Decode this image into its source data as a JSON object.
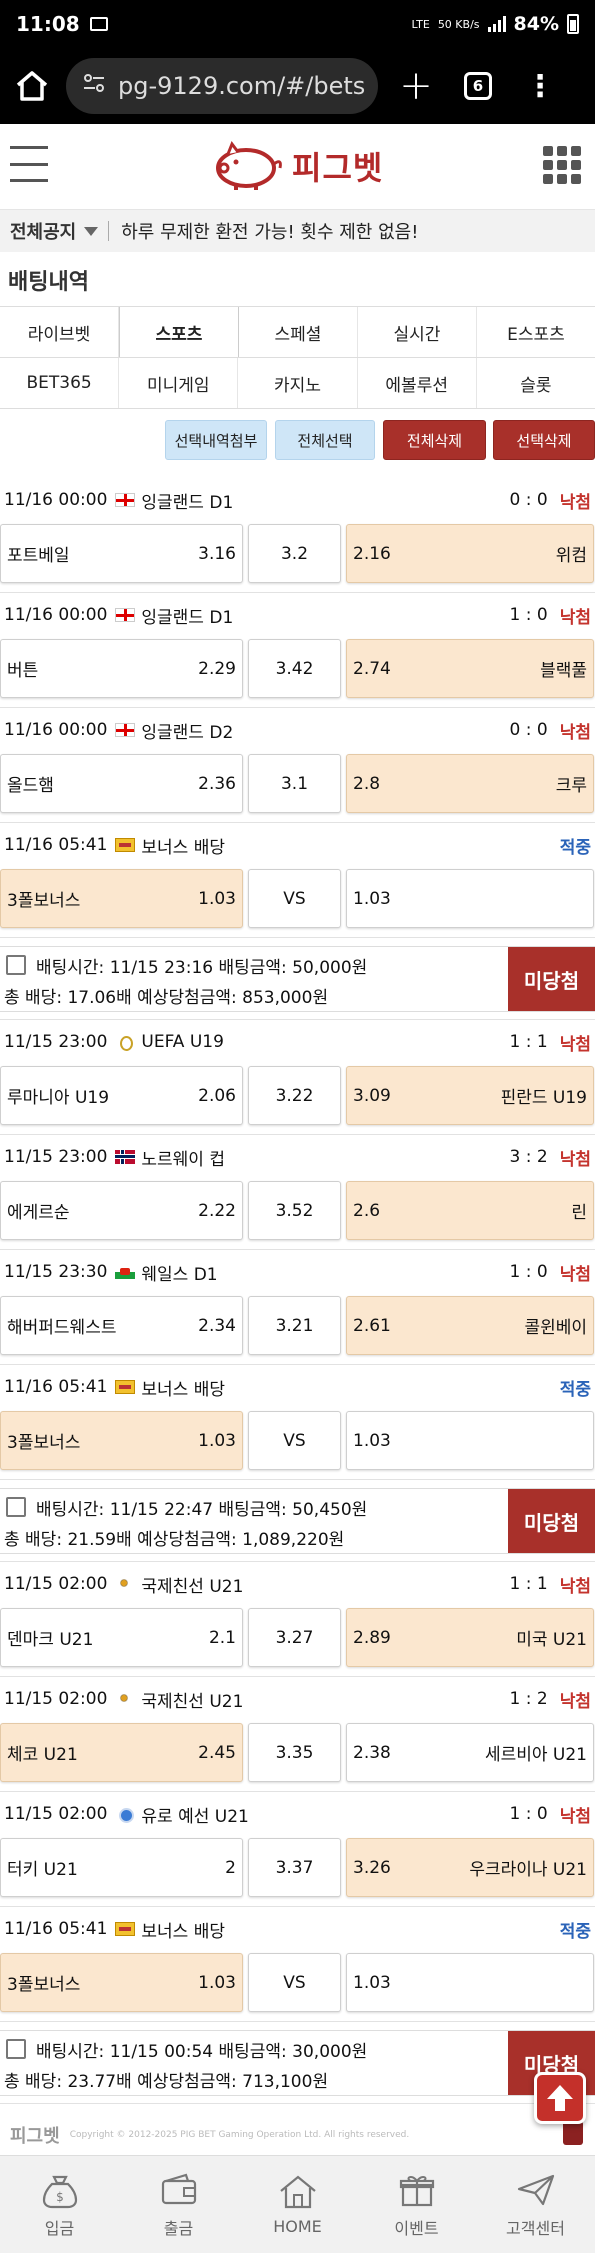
{
  "status": {
    "time": "11:08",
    "net": "LTE",
    "speed": "50 KB/s",
    "battery": "84%"
  },
  "browser": {
    "url": "pg-9129.com/#/bets",
    "tab_count": "6",
    "plus": "+",
    "menu": "⋮"
  },
  "site": {
    "logo_text": "피그벳"
  },
  "notice": {
    "label": "전체공지",
    "text": "하루 무제한 환전 가능! 횟수 제한 없음!"
  },
  "page_title": "배팅내역",
  "tabs_row1": [
    "라이브벳",
    "스포츠",
    "스페셜",
    "실시간",
    "E스포츠"
  ],
  "tabs_row2": [
    "BET365",
    "미니게임",
    "카지노",
    "에볼루션",
    "슬롯"
  ],
  "actions": {
    "attach": "선택내역첨부",
    "select_all": "전체선택",
    "delete_all": "전체삭제",
    "delete_selected": "선택삭제"
  },
  "slips": [
    {
      "bets": [
        {
          "time": "11/16 00:00",
          "flag": "england-flag",
          "league": "잉글랜드 D1",
          "score": "0 : 0",
          "result": "낙첨",
          "result_kind": "lose",
          "home": "포트베일",
          "home_odd": "3.16",
          "draw": "3.2",
          "away": "위컴",
          "away_odd": "2.16",
          "pick": "away"
        },
        {
          "time": "11/16 00:00",
          "flag": "england-flag",
          "league": "잉글랜드 D1",
          "score": "1 : 0",
          "result": "낙첨",
          "result_kind": "lose",
          "home": "버튼",
          "home_odd": "2.29",
          "draw": "3.42",
          "away": "블랙풀",
          "away_odd": "2.74",
          "pick": "away"
        },
        {
          "time": "11/16 00:00",
          "flag": "england-flag",
          "league": "잉글랜드 D2",
          "score": "0 : 0",
          "result": "낙첨",
          "result_kind": "lose",
          "home": "올드햄",
          "home_odd": "2.36",
          "draw": "3.1",
          "away": "크루",
          "away_odd": "2.8",
          "pick": "away"
        },
        {
          "time": "11/16 05:41",
          "flag": "bonus-icon",
          "league": "보너스 배당",
          "score": "",
          "result": "적중",
          "result_kind": "hit",
          "home": "3폴보너스",
          "home_odd": "1.03",
          "draw": "VS",
          "away": "",
          "away_odd": "1.03",
          "pick": "home"
        }
      ],
      "summary": {
        "bet_time": "배팅시간: 11/15 23:16",
        "amount": "배팅금액: 50,000원",
        "total_odds": "총 배당: 17.06배",
        "expected": "예상당첨금액: 853,000원",
        "status": "미당첨"
      }
    },
    {
      "bets": [
        {
          "time": "11/15 23:00",
          "flag": "uefa-icon",
          "league": "UEFA U19",
          "score": "1 : 1",
          "result": "낙첨",
          "result_kind": "lose",
          "home": "루마니아 U19",
          "home_odd": "2.06",
          "draw": "3.22",
          "away": "핀란드 U19",
          "away_odd": "3.09",
          "pick": "away"
        },
        {
          "time": "11/15 23:00",
          "flag": "norway-flag",
          "league": "노르웨이 컵",
          "score": "3 : 2",
          "result": "낙첨",
          "result_kind": "lose",
          "home": "에게르순",
          "home_odd": "2.22",
          "draw": "3.52",
          "away": "린",
          "away_odd": "2.6",
          "pick": "away"
        },
        {
          "time": "11/15 23:30",
          "flag": "wales-flag",
          "league": "웨일스 D1",
          "score": "1 : 0",
          "result": "낙첨",
          "result_kind": "lose",
          "home": "해버퍼드웨스트",
          "home_odd": "2.34",
          "draw": "3.21",
          "away": "콜윈베이",
          "away_odd": "2.61",
          "pick": "away"
        },
        {
          "time": "11/16 05:41",
          "flag": "bonus-icon",
          "league": "보너스 배당",
          "score": "",
          "result": "적중",
          "result_kind": "hit",
          "home": "3폴보너스",
          "home_odd": "1.03",
          "draw": "VS",
          "away": "",
          "away_odd": "1.03",
          "pick": "home"
        }
      ],
      "summary": {
        "bet_time": "배팅시간: 11/15 22:47",
        "amount": "배팅금액: 50,450원",
        "total_odds": "총 배당: 21.59배",
        "expected": "예상당첨금액: 1,089,220원",
        "status": "미당첨"
      }
    },
    {
      "bets": [
        {
          "time": "11/15 02:00",
          "flag": "intl-friendly-icon",
          "league": "국제친선 U21",
          "score": "1 : 1",
          "result": "낙첨",
          "result_kind": "lose",
          "home": "덴마크 U21",
          "home_odd": "2.1",
          "draw": "3.27",
          "away": "미국 U21",
          "away_odd": "2.89",
          "pick": "away"
        },
        {
          "time": "11/15 02:00",
          "flag": "intl-friendly-icon",
          "league": "국제친선 U21",
          "score": "1 : 2",
          "result": "낙첨",
          "result_kind": "lose",
          "home": "체코 U21",
          "home_odd": "2.45",
          "draw": "3.35",
          "away": "세르비아 U21",
          "away_odd": "2.38",
          "pick": "home"
        },
        {
          "time": "11/15 02:00",
          "flag": "euro-qualifier-icon",
          "league": "유로 예선 U21",
          "score": "1 : 0",
          "result": "낙첨",
          "result_kind": "lose",
          "home": "터키 U21",
          "home_odd": "2",
          "draw": "3.37",
          "away": "우크라이나 U21",
          "away_odd": "3.26",
          "pick": "away"
        },
        {
          "time": "11/16 05:41",
          "flag": "bonus-icon",
          "league": "보너스 배당",
          "score": "",
          "result": "적중",
          "result_kind": "hit",
          "home": "3폴보너스",
          "home_odd": "1.03",
          "draw": "VS",
          "away": "",
          "away_odd": "1.03",
          "pick": "home"
        }
      ],
      "summary": {
        "bet_time": "배팅시간: 11/15 00:54",
        "amount": "배팅금액: 30,000원",
        "total_odds": "총 배당: 23.77배",
        "expected": "예상당첨금액: 713,100원",
        "status": "미당첨"
      }
    }
  ],
  "footer": {
    "logo": "피그벳",
    "copyright": "Copyright © 2012-2025 PIG BET Gaming Operation Ltd. All rights reserved."
  },
  "bottom_nav": [
    {
      "label": "입금",
      "icon": "money-bag-icon"
    },
    {
      "label": "출금",
      "icon": "wallet-icon"
    },
    {
      "label": "HOME",
      "icon": "home-icon"
    },
    {
      "label": "이벤트",
      "icon": "gift-icon"
    },
    {
      "label": "고객센터",
      "icon": "paper-plane-icon"
    }
  ],
  "colors": {
    "accent_red": "#a8302a",
    "light_blue": "#cfe6f7",
    "selected_bg": "#fbe7cf",
    "lose": "#c4342e",
    "hit": "#2a63b8"
  }
}
